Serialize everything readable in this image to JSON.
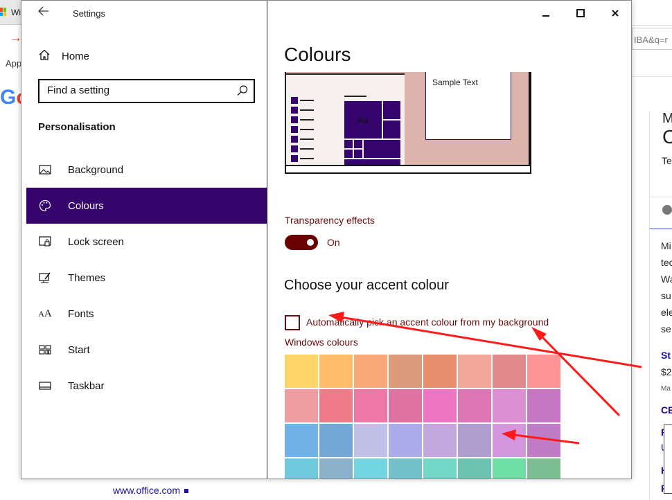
{
  "background": {
    "tab_text": "Wi",
    "apps_text": "App",
    "google_letters": [
      "G",
      "o"
    ],
    "url_fragment": "IBA&q=r",
    "right_snippets": [
      "M",
      "C",
      "Te",
      "Mi",
      "tec",
      "Wa",
      "su",
      "ele",
      "se",
      "St",
      "$2",
      "Ma",
      "CE",
      "F",
      "U",
      "H",
      "F"
    ],
    "footer_link": "www.office.com"
  },
  "window": {
    "title": "Settings",
    "controls": {
      "minimize": "—",
      "maximize": "☐",
      "close": "✕"
    }
  },
  "sidebar": {
    "home_label": "Home",
    "search_placeholder": "Find a setting",
    "section_title": "Personalisation",
    "items": [
      {
        "label": "Background",
        "icon": "picture-icon",
        "active": false
      },
      {
        "label": "Colours",
        "icon": "palette-icon",
        "active": true
      },
      {
        "label": "Lock screen",
        "icon": "lock-screen-icon",
        "active": false
      },
      {
        "label": "Themes",
        "icon": "themes-icon",
        "active": false
      },
      {
        "label": "Fonts",
        "icon": "fonts-icon",
        "active": false
      },
      {
        "label": "Start",
        "icon": "start-icon",
        "active": false
      },
      {
        "label": "Taskbar",
        "icon": "taskbar-icon",
        "active": false
      }
    ]
  },
  "main": {
    "title": "Colours",
    "preview": {
      "sample_text": "Sample Text",
      "tile_text": "Aa"
    },
    "transparency": {
      "label": "Transparency effects",
      "state": "On"
    },
    "accent_heading": "Choose your accent colour",
    "auto_pick_label": "Automatically pick an accent colour from my background",
    "windows_colours_label": "Windows colours",
    "swatch_colors": [
      "#ffd56a",
      "#ffbc6b",
      "#f8a877",
      "#dc9b7a",
      "#e8906e",
      "#f2a799",
      "#e08a8c",
      "#fd9595",
      "#ef9da1",
      "#ef7a88",
      "#ef77a5",
      "#de73a1",
      "#ef75c3",
      "#de76b5",
      "#dc8ed3",
      "#c676c1",
      "#72b1e6",
      "#74a6d6",
      "#c0c0e8",
      "#adacea",
      "#c3a8dd",
      "#b09fce",
      "#d496dd",
      "#c07cc7",
      "#6fc9dc",
      "#8ab1c9",
      "#72d6e0",
      "#73c2cb",
      "#74d8c8",
      "#6dc3b2",
      "#6fe0a5",
      "#7dbf93"
    ]
  },
  "colors": {
    "accent": "#35056d",
    "toggle": "#6b0000",
    "label_red": "#6b0b0b",
    "annotation_arrow": "#ff1a1a"
  }
}
